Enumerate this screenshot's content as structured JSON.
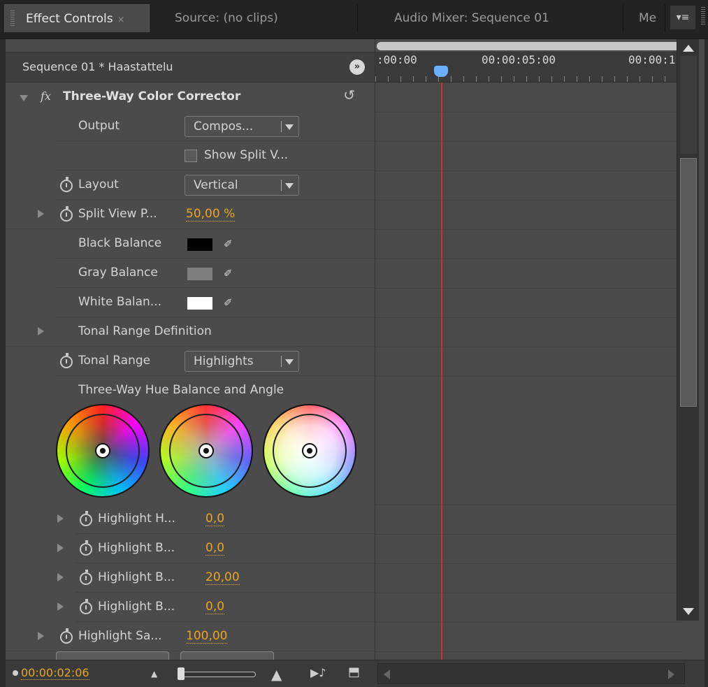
{
  "tabs": [
    {
      "label": "Effect Controls",
      "active": true
    },
    {
      "label": "Source: (no clips)",
      "active": false
    },
    {
      "label": "Audio Mixer: Sequence 01",
      "active": false
    },
    {
      "label": "Me",
      "active": false
    }
  ],
  "tab_close": "×",
  "tab_menu": "▾≡",
  "sequence": {
    "title": "Sequence 01 * Haastattelu",
    "expand": "»"
  },
  "effect": {
    "name": "Three-Way Color Corrector",
    "fx_icon": "fx",
    "reset_icon": "↺"
  },
  "properties": {
    "output": {
      "label": "Output",
      "value": "Compos..."
    },
    "show_split": {
      "label": "Show Split V...",
      "checked": false
    },
    "layout": {
      "label": "Layout",
      "value": "Vertical"
    },
    "split_view": {
      "label": "Split View P...",
      "value": "50,00 %"
    },
    "black_balance": {
      "label": "Black Balance",
      "color": "#000000"
    },
    "gray_balance": {
      "label": "Gray Balance",
      "color": "#7f7f7f"
    },
    "white_balance": {
      "label": "White Balan...",
      "color": "#ffffff"
    },
    "tonal_def": {
      "label": "Tonal Range Definition"
    },
    "tonal_range": {
      "label": "Tonal Range",
      "value": "Highlights"
    },
    "hue_balance": {
      "label": "Three-Way Hue Balance and Angle"
    },
    "hl_rows": [
      {
        "label": "Highlight H...",
        "value": "0,0"
      },
      {
        "label": "Highlight B...",
        "value": "0,0"
      },
      {
        "label": "Highlight B...",
        "value": "20,00"
      },
      {
        "label": "Highlight B...",
        "value": "0,0"
      }
    ],
    "hl_saturation": {
      "label": "Highlight Sa...",
      "value": "100,00"
    }
  },
  "timeline": {
    "ticks": [
      ":00:00",
      "00:00:05:00",
      "00:00:1("
    ]
  },
  "bottom": {
    "timecode": "00:00:02:06"
  },
  "icons": {
    "eyedropper": "✐",
    "zoom_out": "▲",
    "zoom_in": "▲",
    "play_audio": "▶♪",
    "export": "⬒"
  },
  "colors": {
    "accent_value": "#e8a624",
    "playhead": "#d03030"
  }
}
